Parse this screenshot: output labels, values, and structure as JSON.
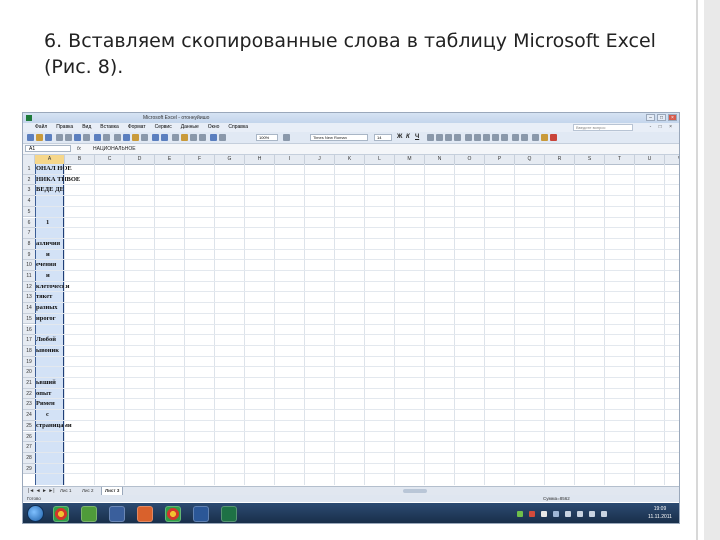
{
  "slide": {
    "heading_line1": "6. Вставляем скопированные слова в таблицу Microsoft Excel",
    "heading_line2": "(Рис. 8)."
  },
  "excel": {
    "window_title": "Microsoft Excel - отоннуйишо",
    "menu": [
      "Файл",
      "Правка",
      "Вид",
      "Вставка",
      "Формат",
      "Сервис",
      "Данные",
      "Окно",
      "Справка"
    ],
    "help_placeholder": "Введите вопрос",
    "zoom": "100%",
    "font_name": "Times New Roman",
    "font_size": "14",
    "bold_label": "Ж",
    "italic_label": "К",
    "underline_label": "Ч",
    "name_box": "A1",
    "fx_label": "fx",
    "formula_content": "НАЦИОНАЛЬНОЕ",
    "columns": [
      "A",
      "B",
      "C",
      "D",
      "E",
      "F",
      "G",
      "H",
      "I",
      "J",
      "K",
      "L",
      "M",
      "N",
      "O",
      "P",
      "Q",
      "R",
      "S",
      "T",
      "U",
      "V"
    ],
    "rows": [
      "1",
      "2",
      "3",
      "4",
      "5",
      "6",
      "7",
      "8",
      "9",
      "10",
      "11",
      "12",
      "13",
      "14",
      "15",
      "16",
      "17",
      "18",
      "19",
      "20",
      "21",
      "22",
      "23",
      "24",
      "25",
      "26",
      "27",
      "28",
      "29"
    ],
    "cells": [
      {
        "row": 1,
        "text": "ОНАЛ НОЕ"
      },
      {
        "row": 2,
        "text": "НИКА ТИВОЕ"
      },
      {
        "row": 3,
        "text": "ВЕДЕ ДЕ"
      },
      {
        "row": 6,
        "text": "1"
      },
      {
        "row": 8,
        "text": "азличия"
      },
      {
        "row": 9,
        "text": "и"
      },
      {
        "row": 10,
        "text": "ечения"
      },
      {
        "row": 11,
        "text": "и"
      },
      {
        "row": 12,
        "text": "клеточески"
      },
      {
        "row": 13,
        "text": "тякет"
      },
      {
        "row": 14,
        "text": "разных"
      },
      {
        "row": 15,
        "text": "ирогог"
      },
      {
        "row": 17,
        "text": "Любой"
      },
      {
        "row": 18,
        "text": "ывоник"
      },
      {
        "row": 21,
        "text": "ьвший"
      },
      {
        "row": 22,
        "text": "опыт"
      },
      {
        "row": 23,
        "text": "Римен"
      },
      {
        "row": 24,
        "text": "с"
      },
      {
        "row": 25,
        "text": "страницами"
      }
    ],
    "sheet_tabs": [
      "Лис 1",
      "Лис 2",
      "Лист 3"
    ],
    "status_left": "Готово",
    "status_right": "Сумма=8562",
    "clock_time": "19:09",
    "clock_date": "11.11.2011",
    "colors": {
      "selection_fill": "#d3e2f6",
      "selection_border": "#1f3f78",
      "taskbar": "#1c3554"
    },
    "taskbar_icons": [
      "chrome-icon",
      "utorrent-icon",
      "save-icon",
      "presentation-icon",
      "chrome-icon",
      "word-icon",
      "excel-icon"
    ]
  }
}
